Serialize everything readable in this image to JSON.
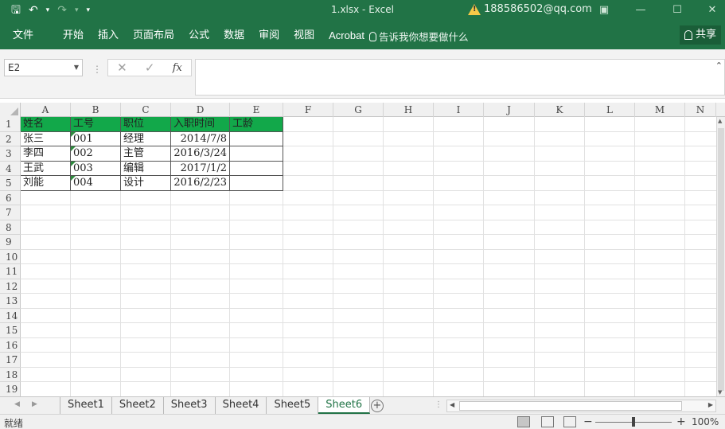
{
  "window": {
    "title": "1.xlsx  -  Excel",
    "account": "188586502@qq.com",
    "quick_access": {
      "save": "🖫",
      "undo": "↶",
      "undo_more": "▾",
      "redo": "↷",
      "redo_more": "▾",
      "customize": "▾"
    },
    "controls": {
      "ribbon_options": "▣",
      "minimize": "—",
      "maximize": "☐",
      "close": "✕"
    }
  },
  "ribbon": {
    "tabs": [
      "文件",
      "开始",
      "插入",
      "页面布局",
      "公式",
      "数据",
      "审阅",
      "视图",
      "Acrobat"
    ],
    "tell_me": "告诉我你想要做什么",
    "share": "共享"
  },
  "formula_bar": {
    "name_box": "E2",
    "cancel": "✕",
    "enter": "✓",
    "fx": "fx",
    "formula": ""
  },
  "grid": {
    "columns": [
      "A",
      "B",
      "C",
      "D",
      "E",
      "F",
      "G",
      "H",
      "I",
      "J",
      "K",
      "L",
      "M",
      "N"
    ],
    "rows": [
      "1",
      "2",
      "3",
      "4",
      "5",
      "6",
      "7",
      "8",
      "9",
      "10",
      "11",
      "12",
      "13",
      "14",
      "15",
      "16",
      "17",
      "18",
      "19"
    ],
    "header_row": [
      "姓名",
      "工号",
      "职位",
      "入职时间",
      "工龄"
    ],
    "data_rows": [
      [
        "张三",
        "001",
        "经理",
        "2014/7/8",
        ""
      ],
      [
        "李四",
        "002",
        "主管",
        "2016/3/24",
        ""
      ],
      [
        "王武",
        "003",
        "编辑",
        "2017/1/2",
        ""
      ],
      [
        "刘能",
        "004",
        "设计",
        "2016/2/23",
        ""
      ]
    ],
    "header_fill": "#12a84a"
  },
  "sheets": {
    "tabs": [
      "Sheet1",
      "Sheet2",
      "Sheet3",
      "Sheet4",
      "Sheet5",
      "Sheet6"
    ],
    "active": "Sheet6"
  },
  "status": {
    "ready": "就绪",
    "zoom": "100%"
  },
  "colors": {
    "excel_green": "#217346",
    "header_fill": "#12a84a"
  }
}
